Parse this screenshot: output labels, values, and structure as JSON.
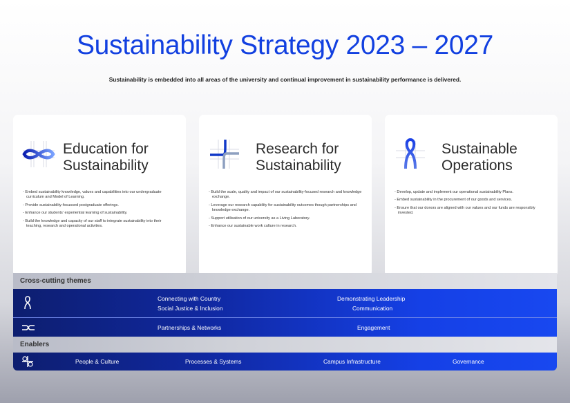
{
  "title": "Sustainability Strategy 2023 – 2027",
  "subtitle": "Sustainability is embedded into all areas of the university and continual improvement in sustainability performance is delivered.",
  "cards": [
    {
      "heading_line1": "Education for",
      "heading_line2": "Sustainability",
      "icon": "infinity-loop-icon",
      "items": [
        "Embed sustainability knowledge, values and capabilities into our undergraduate curriculum and Model of Learning.",
        "Provide sustainability-focussed postgraduate offerings.",
        "Enhance our students' experiential learning of sustainability.",
        "Build the knowledge and capacity of our staff to integrate sustainability into their teaching, research and operational activities."
      ]
    },
    {
      "heading_line1": "Research for",
      "heading_line2": "Sustainability",
      "icon": "crossing-lines-icon",
      "items": [
        "Build the scale, quality and impact of our sustainability-focused research and knowledge exchange.",
        "Leverage our research capability for sustainability outcomes though partnerships and knowledge exchange.",
        "Support utilisation of our university as a Living Laboratory.",
        "Enhance our sustainable work culture in research."
      ]
    },
    {
      "heading_line1": "Sustainable",
      "heading_line2": "Operations",
      "icon": "figure-eight-icon",
      "items": [
        "Develop, update and implement our operational sustainability Plans.",
        "Embed sustainability in the procurement of our goods and services.",
        "Ensure that our donors are aligned with our values and our funds are responsibly invested."
      ]
    }
  ],
  "cross_cutting": {
    "label": "Cross-cutting themes",
    "row1": {
      "icon": "figure-eight-icon",
      "left_line1": "Connecting with Country",
      "left_line2": "Social Justice & Inclusion",
      "right_line1": "Demonstrating Leadership",
      "right_line2": "Communication"
    },
    "row2": {
      "icon": "crossover-icon",
      "left": "Partnerships & Networks",
      "right": "Engagement"
    }
  },
  "enablers": {
    "label": "Enablers",
    "icon": "clover-cross-icon",
    "items": [
      "People & Culture",
      "Processes & Systems",
      "Campus Infrastructure",
      "Governance"
    ]
  },
  "colors": {
    "accent": "#1240e0",
    "bar_dark": "#0d1e6f",
    "bar_light": "#1848f0"
  }
}
